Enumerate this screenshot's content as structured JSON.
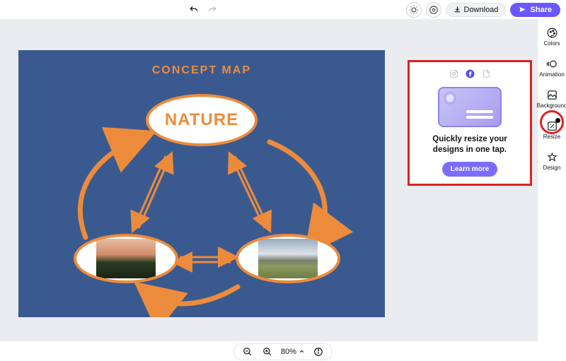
{
  "topbar": {
    "download_label": "Download",
    "share_label": "Share"
  },
  "rail": {
    "colors": "Colors",
    "animation": "Animation",
    "background": "Background",
    "resize": "Resize",
    "design": "Design"
  },
  "canvas": {
    "title": "CONCEPT MAP",
    "center_label": "NATURE"
  },
  "popup": {
    "message": "Quickly resize your designs in one tap.",
    "cta": "Learn more"
  },
  "bottombar": {
    "zoom": "80%"
  },
  "icons": {
    "undo": "undo-icon",
    "redo": "redo-icon"
  }
}
